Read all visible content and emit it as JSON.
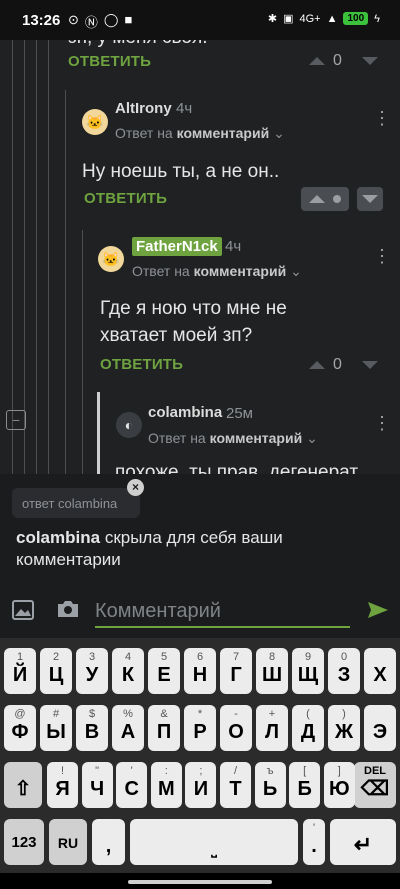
{
  "status_bar": {
    "time": "13:26",
    "left_icons": [
      "notification-icon",
      "nfc-icon",
      "whatsapp-icon",
      "square-icon"
    ],
    "right_icons": [
      "bluetooth-icon",
      "volte-icon",
      "signal-icon"
    ],
    "network": "4G+",
    "battery": "100"
  },
  "comments": [
    {
      "text": "зп, у меня своя.",
      "reply_label": "ОТВЕТИТЬ",
      "score": "0"
    },
    {
      "user": "AltIrony",
      "time": "4ч",
      "reply_to_prefix": "Ответ на",
      "reply_to_target": "комментарий",
      "text": "Ну ноешь ты, а не он..",
      "reply_label": "ОТВЕТИТЬ",
      "score": ""
    },
    {
      "user": "FatherN1ck",
      "time": "4ч",
      "reply_to_prefix": "Ответ на",
      "reply_to_target": "комментарий",
      "text": "Где я ною что мне не хватает моей зп?",
      "reply_label": "ОТВЕТИТЬ",
      "score": "0"
    },
    {
      "user": "colambina",
      "time": "25м",
      "reply_to_prefix": "Ответ на",
      "reply_to_target": "комментарий",
      "text": "похоже, ты прав, дегенерат"
    }
  ],
  "reply_panel": {
    "chip_text": "ответ colambina",
    "notice_user": "colambina",
    "notice_text": " скрыла для себя ваши комментарии",
    "input_placeholder": "Комментарий"
  },
  "keyboard": {
    "row1": [
      [
        "1",
        "Й"
      ],
      [
        "2",
        "Ц"
      ],
      [
        "3",
        "У"
      ],
      [
        "4",
        "К"
      ],
      [
        "5",
        "Е"
      ],
      [
        "6",
        "Н"
      ],
      [
        "7",
        "Г"
      ],
      [
        "8",
        "Ш"
      ],
      [
        "9",
        "Щ"
      ],
      [
        "0",
        "З"
      ],
      [
        "",
        "Х"
      ]
    ],
    "row2": [
      [
        "@",
        "Ф"
      ],
      [
        "#",
        "Ы"
      ],
      [
        "$",
        "В"
      ],
      [
        "%",
        "А"
      ],
      [
        "&",
        "П"
      ],
      [
        "*",
        "Р"
      ],
      [
        "-",
        "О"
      ],
      [
        "+",
        "Л"
      ],
      [
        "(",
        "Д"
      ],
      [
        ")",
        "Ж"
      ],
      [
        "",
        "Э"
      ]
    ],
    "row3": [
      [
        "!",
        "Я"
      ],
      [
        "\"",
        "Ч"
      ],
      [
        "'",
        "С"
      ],
      [
        ":",
        "М"
      ],
      [
        ";",
        "И"
      ],
      [
        "/",
        "Т"
      ],
      [
        "ъ",
        "Ь"
      ],
      [
        "[",
        "Б"
      ],
      [
        "]",
        "Ю"
      ]
    ],
    "del_label": "DEL",
    "key_123": "123",
    "key_lang": "RU",
    "key_comma": ",",
    "key_period": ".",
    "key_period_hint": "'"
  }
}
